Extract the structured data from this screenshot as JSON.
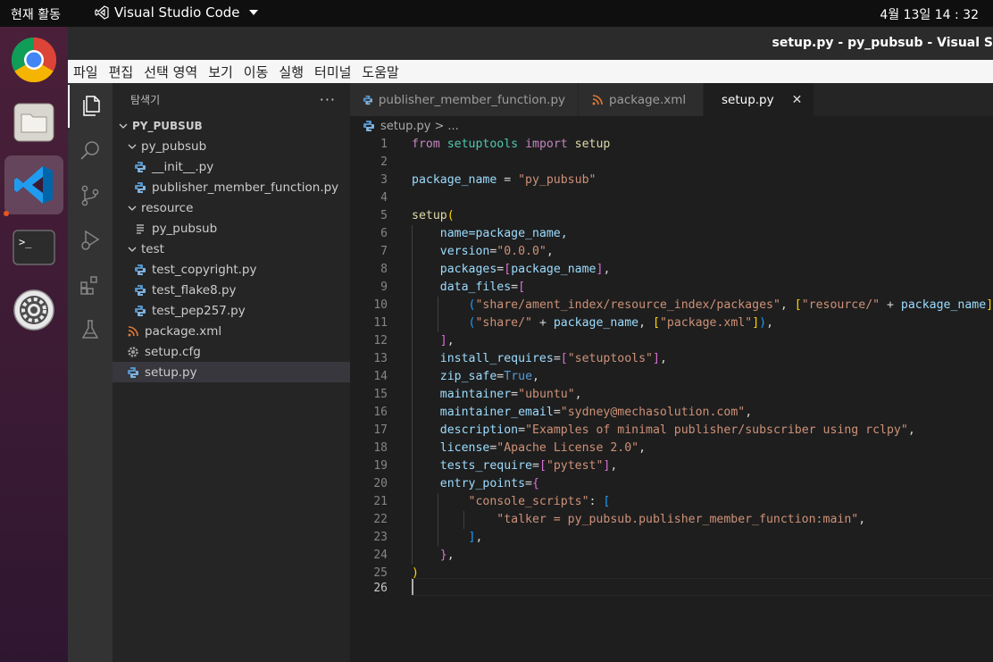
{
  "topbar": {
    "activities": "현재 활동",
    "app_name": "Visual Studio Code",
    "clock": "4월 13일  14 : 32"
  },
  "dock": {
    "items": [
      "chrome-icon",
      "files-icon",
      "vscode-icon",
      "terminal-icon",
      "settings-icon"
    ]
  },
  "window": {
    "title": "setup.py - py_pubsub - Visual S"
  },
  "menubar": {
    "items": [
      "파일",
      "편집",
      "선택 영역",
      "보기",
      "이동",
      "실행",
      "터미널",
      "도움말"
    ]
  },
  "sidebar": {
    "header": "탐색기",
    "more": "···",
    "root": "PY_PUBSUB",
    "tree": [
      {
        "label": "py_pubsub",
        "type": "folder"
      },
      {
        "label": "__init__.py",
        "type": "python"
      },
      {
        "label": "publisher_member_function.py",
        "type": "python"
      },
      {
        "label": "resource",
        "type": "folder"
      },
      {
        "label": "py_pubsub",
        "type": "text"
      },
      {
        "label": "test",
        "type": "folder"
      },
      {
        "label": "test_copyright.py",
        "type": "python"
      },
      {
        "label": "test_flake8.py",
        "type": "python"
      },
      {
        "label": "test_pep257.py",
        "type": "python"
      },
      {
        "label": "package.xml",
        "type": "rss"
      },
      {
        "label": "setup.cfg",
        "type": "gear"
      },
      {
        "label": "setup.py",
        "type": "python",
        "selected": true
      }
    ]
  },
  "tabs": [
    {
      "label": "publisher_member_function.py",
      "icon": "python"
    },
    {
      "label": "package.xml",
      "icon": "rss"
    },
    {
      "label": "setup.py",
      "icon": "python",
      "active": true
    }
  ],
  "breadcrumb": {
    "file": "setup.py",
    "sep": ">",
    "rest": "..."
  },
  "editor": {
    "line_numbers": [
      "1",
      "2",
      "3",
      "4",
      "5",
      "6",
      "7",
      "8",
      "9",
      "10",
      "11",
      "12",
      "13",
      "14",
      "15",
      "16",
      "17",
      "18",
      "19",
      "20",
      "21",
      "22",
      "23",
      "24",
      "25",
      "26"
    ],
    "code": {
      "l1_from": "from",
      "l1_mod": "setuptools",
      "l1_import": "import",
      "l1_name": "setup",
      "l3_var": "package_name",
      "l3_eq": " = ",
      "l3_str": "\"py_pubsub\"",
      "l5_fn": "setup",
      "l5_br": "(",
      "l6_key": "name",
      "l6_rest": "=package_name,",
      "l7_key": "version",
      "l7_eq": "=",
      "l7_str": "\"0.0.0\"",
      "l7_end": ",",
      "l8_key": "packages",
      "l8_eq": "=",
      "l8_br1": "[",
      "l8_val": "package_name",
      "l8_br2": "]",
      "l8_end": ",",
      "l9_key": "data_files",
      "l9_eq": "=",
      "l9_br": "[",
      "l10_br1": "(",
      "l10_str1": "\"share/ament_index/resource_index/packages\"",
      "l10_c": ", ",
      "l10_br2": "[",
      "l10_str2": "\"resource/\"",
      "l10_plus": " + ",
      "l10_var": "package_name",
      "l10_br3": "]",
      "l10_br4": ")",
      "l10_end": ",",
      "l11_br1": "(",
      "l11_str1": "\"share/\"",
      "l11_plus": " + ",
      "l11_var": "package_name",
      "l11_c": ", ",
      "l11_br2": "[",
      "l11_str2": "\"package.xml\"",
      "l11_br3": "]",
      "l11_br4": ")",
      "l11_end": ",",
      "l12_br": "]",
      "l12_end": ",",
      "l13_key": "install_requires",
      "l13_eq": "=",
      "l13_br1": "[",
      "l13_str": "\"setuptools\"",
      "l13_br2": "]",
      "l13_end": ",",
      "l14_key": "zip_safe",
      "l14_eq": "=",
      "l14_val": "True",
      "l14_end": ",",
      "l15_key": "maintainer",
      "l15_eq": "=",
      "l15_str": "\"ubuntu\"",
      "l15_end": ",",
      "l16_key": "maintainer_email",
      "l16_eq": "=",
      "l16_str": "\"sydney@mechasolution.com\"",
      "l16_end": ",",
      "l17_key": "description",
      "l17_eq": "=",
      "l17_str": "\"Examples of minimal publisher/subscriber using rclpy\"",
      "l17_end": ",",
      "l18_key": "license",
      "l18_eq": "=",
      "l18_str": "\"Apache License 2.0\"",
      "l18_end": ",",
      "l19_key": "tests_require",
      "l19_eq": "=",
      "l19_br1": "[",
      "l19_str": "\"pytest\"",
      "l19_br2": "]",
      "l19_end": ",",
      "l20_key": "entry_points",
      "l20_eq": "=",
      "l20_br": "{",
      "l21_str": "\"console_scripts\"",
      "l21_colon": ": ",
      "l21_br": "[",
      "l22_str": "\"talker = py_pubsub.publisher_member_function:main\"",
      "l22_end": ",",
      "l23_br": "]",
      "l23_end": ",",
      "l24_br": "}",
      "l24_end": ",",
      "l25_br": ")"
    }
  }
}
